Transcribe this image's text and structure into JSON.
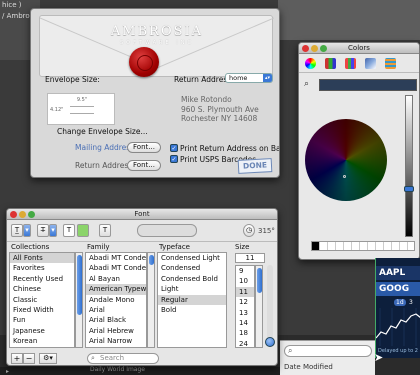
{
  "desktop": {
    "top_left_lines": [
      "hice )",
      "/ Ambros"
    ],
    "finder_label": "Date Modified",
    "bottom_item": "Daily World Image"
  },
  "envelope": {
    "brand": "AMBROSIA",
    "brand_sub": "SOFTWARE INC",
    "envelope_size_label": "Envelope Size:",
    "return_address_label": "Return Address:",
    "return_address_value": "home",
    "preview_width": "9.5\"",
    "preview_height": "4.12\"",
    "change_size_label": "Change Envelope Size...",
    "address_lines": "Mike Rotondo\n960 S. Plymouth Ave\nRochester NY 14608",
    "mailing_address_label": "Mailing Address",
    "return_address_row_label": "Return Address",
    "font_button": "Font...",
    "print_return_label": "Print Return Address on Back",
    "print_usps_label": "Print USPS Barcodes",
    "done_label": "DONE"
  },
  "colors": {
    "title": "Colors",
    "swatch_color": "#2c3e58"
  },
  "font_panel": {
    "title": "Font",
    "rotation": "315°",
    "headers": {
      "collections": "Collections",
      "family": "Family",
      "typeface": "Typeface",
      "size": "Size"
    },
    "collections": [
      "All Fonts",
      "Favorites",
      "Recently Used",
      "Chinese",
      "Classic",
      "Fixed Width",
      "Fun",
      "Japanese",
      "Korean"
    ],
    "families": [
      "Abadi MT Condens",
      "Abadi MT Condens",
      "Al Bayan",
      "American Typewrit",
      "Andale Mono",
      "Arial",
      "Arial Black",
      "Arial Hebrew",
      "Arial Narrow"
    ],
    "typefaces": [
      "Condensed Light",
      "Condensed",
      "Condensed Bold",
      "Light",
      "Regular",
      "Bold"
    ],
    "size_value": "11",
    "sizes": [
      "9",
      "10",
      "11",
      "12",
      "13",
      "14",
      "18",
      "24"
    ],
    "search_placeholder": "Search",
    "add_label": "+",
    "remove_label": "−",
    "action_label": "⚙▾"
  },
  "stock": {
    "ticker1": "AAPL",
    "ticker2": "GOOG",
    "range_selected": "1d",
    "range_other": "3",
    "delay_note": "Delayed up to 2",
    "chart_points": [
      30,
      24,
      26,
      18,
      20,
      12,
      14,
      8,
      6,
      10
    ]
  }
}
